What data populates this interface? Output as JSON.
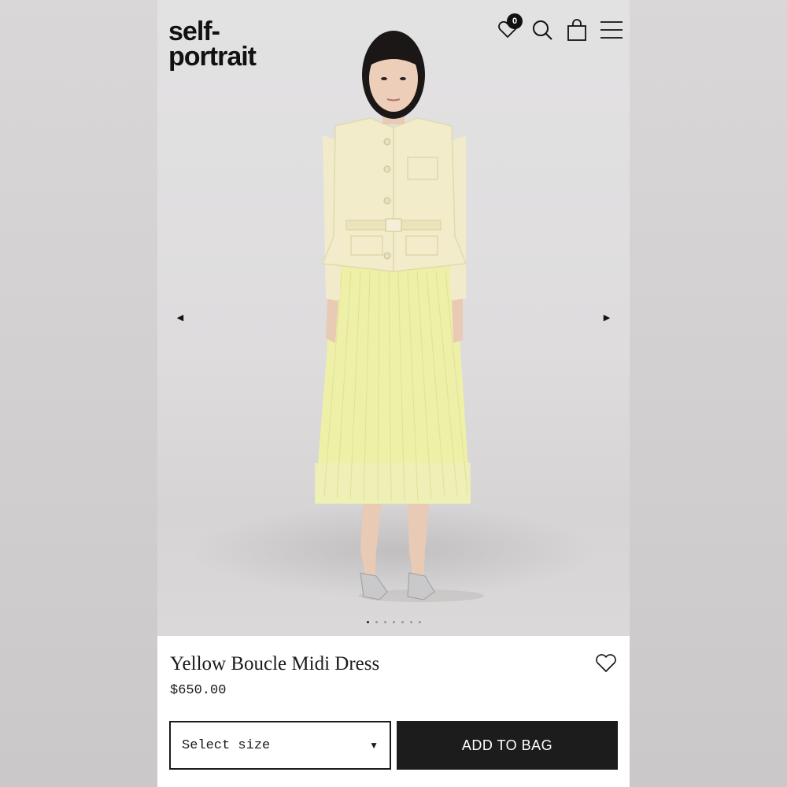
{
  "brand": {
    "line1": "self-",
    "line2": "portrait"
  },
  "header": {
    "wishlist_count": "0",
    "icons": [
      "heart-icon",
      "search-icon",
      "bag-icon",
      "menu-icon"
    ]
  },
  "gallery": {
    "prev_arrow": "◀",
    "next_arrow": "▶",
    "slide_count": 7,
    "active_slide": 1
  },
  "product": {
    "name": "Yellow Boucle Midi Dress",
    "price": "$650.00"
  },
  "actions": {
    "size_placeholder": "Select size",
    "size_caret": "▼",
    "add_to_bag": "ADD TO BAG"
  },
  "colors": {
    "jacket": "#f2eccb",
    "skirt": "#eef0a8",
    "button": "#1c1c1c"
  }
}
